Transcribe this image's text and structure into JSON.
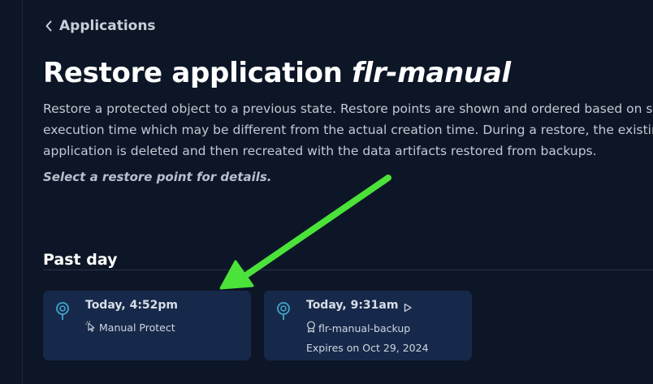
{
  "breadcrumb": {
    "label": "Applications"
  },
  "header": {
    "title_prefix": "Restore application",
    "app_name": "flr-manual"
  },
  "description": {
    "lines": [
      "Restore a protected object to a previous state. Restore points are shown and ordered based on sched",
      "execution time which may be different from the actual creation time. During a restore, the existing",
      "application is deleted and then recreated with the data artifacts restored from backups."
    ]
  },
  "hint": "Select a restore point for details.",
  "section": {
    "title": "Past day"
  },
  "restore_points": [
    {
      "time": "Today, 4:52pm",
      "icon": "manual-protect-icon",
      "label": "Manual Protect"
    },
    {
      "time": "Today, 9:31am",
      "icon": "policy-badge-icon",
      "label": "flr-manual-backup",
      "expires": "Expires on Oct 29, 2024",
      "play_icon": "play-icon"
    }
  ],
  "colors": {
    "background": "#0d1626",
    "card": "#17294a",
    "pin_accent": "#3ea6c9",
    "annotation_arrow": "#4be33a"
  }
}
